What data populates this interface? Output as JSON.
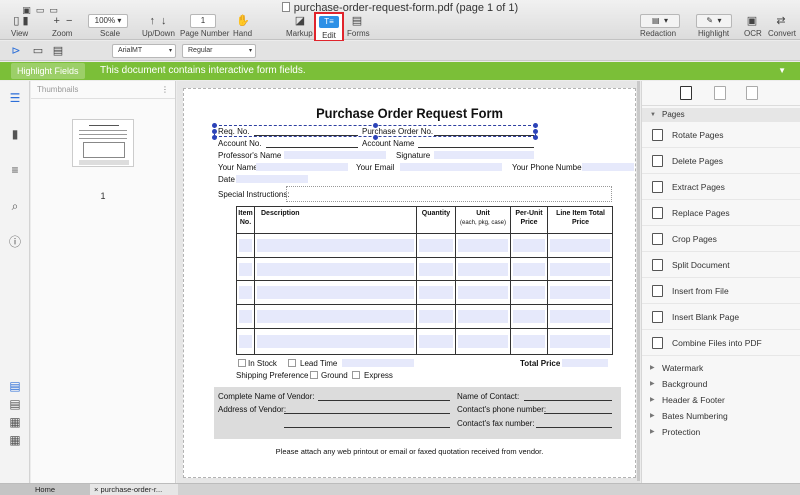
{
  "window": {
    "title": "purchase-order-request-form.pdf (page 1 of 1)"
  },
  "toolbar": {
    "view": "View",
    "zoom": "Zoom",
    "scale": "Scale",
    "scale_value": "100%",
    "updown": "Up/Down",
    "page_number": "Page Number",
    "page_value": "1",
    "hand": "Hand",
    "markup": "Markup",
    "edit": "Edit",
    "forms": "Forms",
    "redaction": "Redaction",
    "highlight": "Highlight",
    "ocr": "OCR",
    "convert": "Convert"
  },
  "fontbar": {
    "font": "ArialMT",
    "style": "Regular"
  },
  "banner": {
    "button": "Highlight Fields",
    "message": "This document contains interactive form fields.",
    "color": "#7bbf38"
  },
  "thumbnails": {
    "header": "Thumbnails",
    "page_number": "1"
  },
  "form": {
    "title": "Purchase Order Request Form",
    "req_no": "Req. No.",
    "po_no": "Purchase Order No.",
    "account_no": "Account No.",
    "account_name": "Account Name",
    "professor": "Professor's Name",
    "signature": "Signature",
    "your_name": "Your Name",
    "your_email": "Your Email",
    "your_phone": "Your Phone Number",
    "date": "Date",
    "special": "Special Instructions:",
    "headers": {
      "item": "Item No.",
      "description": "Description",
      "quantity": "Quantity",
      "unit": "Unit",
      "unit_sub": "(each, pkg, case)",
      "per_unit": "Per-Unit Price",
      "line_total": "Line Item Total Price"
    },
    "in_stock": "In Stock",
    "lead_time": "Lead Time",
    "total_price": "Total Price",
    "shipping": "Shipping Preference",
    "ground": "Ground",
    "express": "Express",
    "vendor_name": "Complete Name of Vendor:",
    "vendor_address": "Address of Vendor:",
    "contact_name": "Name of Contact:",
    "contact_phone": "Contact's phone number:",
    "contact_fax": "Contact's fax number:",
    "note": "Please attach any web printout or email or faxed quotation received from vendor."
  },
  "right_panel": {
    "section": "Pages",
    "items": [
      "Rotate Pages",
      "Delete Pages",
      "Extract Pages",
      "Replace Pages",
      "Crop Pages",
      "Split Document",
      "Insert from File",
      "Insert Blank Page",
      "Combine Files into PDF"
    ],
    "subsections": [
      "Watermark",
      "Background",
      "Header & Footer",
      "Bates Numbering",
      "Protection"
    ]
  },
  "tabs": {
    "home": "Home",
    "doc": "purchase-order-r..."
  },
  "colors": {
    "accent": "#2d90e6",
    "highlight_border": "#e0242c",
    "field": "#e6e9fb"
  }
}
